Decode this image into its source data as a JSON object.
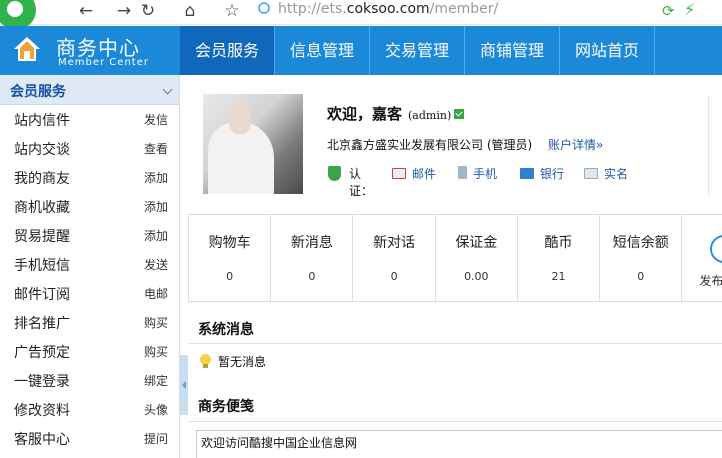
{
  "browser": {
    "back_icon": "back-arrow-icon",
    "url_scheme_prefix": "http://ets.",
    "url_host": "coksoo.com",
    "url_path": "/member/"
  },
  "header": {
    "title_cn": "商务中心",
    "title_en": "Member Center",
    "nav": [
      {
        "label": "会员服务",
        "active": true
      },
      {
        "label": "信息管理",
        "active": false
      },
      {
        "label": "交易管理",
        "active": false
      },
      {
        "label": "商铺管理",
        "active": false
      },
      {
        "label": "网站首页",
        "active": false
      }
    ],
    "color": "#1c89d8",
    "active_color": "#1068ba"
  },
  "sidebar": {
    "heading": "会员服务",
    "items": [
      {
        "label": "站内信件",
        "action": "发信"
      },
      {
        "label": "站内交谈",
        "action": "查看"
      },
      {
        "label": "我的商友",
        "action": "添加"
      },
      {
        "label": "商机收藏",
        "action": "添加"
      },
      {
        "label": "贸易提醒",
        "action": "添加"
      },
      {
        "label": "手机短信",
        "action": "发送"
      },
      {
        "label": "邮件订阅",
        "action": "电邮"
      },
      {
        "label": "排名推广",
        "action": "购买"
      },
      {
        "label": "广告预定",
        "action": "购买"
      },
      {
        "label": "一键登录",
        "action": "绑定"
      },
      {
        "label": "修改资料",
        "action": "头像"
      },
      {
        "label": "客服中心",
        "action": "提问"
      }
    ]
  },
  "profile": {
    "welcome": "欢迎，嘉客",
    "username": "(admin)",
    "company": "北京鑫方盛实业发展有限公司 (管理员)",
    "account_link": "账户详情»",
    "auth_label": "认证：",
    "auth_items": [
      {
        "label": "邮件",
        "icon": "mail-icon"
      },
      {
        "label": "手机",
        "icon": "mobile-icon"
      },
      {
        "label": "银行",
        "icon": "bank-card-icon"
      },
      {
        "label": "实名",
        "icon": "id-card-icon"
      }
    ]
  },
  "stats": [
    {
      "title": "购物车",
      "value": "0"
    },
    {
      "title": "新消息",
      "value": "0"
    },
    {
      "title": "新对话",
      "value": "0"
    },
    {
      "title": "保证金",
      "value": "0.00"
    },
    {
      "title": "酷币",
      "value": "21"
    },
    {
      "title": "短信余额",
      "value": "0"
    }
  ],
  "stats_extra": {
    "label": "发布"
  },
  "system_messages": {
    "title": "系统消息",
    "empty": "暂无消息"
  },
  "memo": {
    "title": "商务便笺",
    "content": "欢迎访问酷搜中国企业信息网"
  }
}
